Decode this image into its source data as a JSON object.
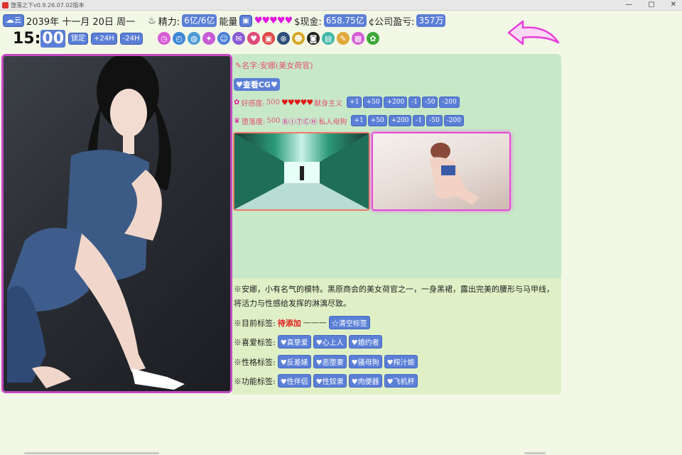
{
  "window": {
    "title": "堕落之下v0.9.26.07.02版本",
    "controls": [
      "—",
      "▢",
      "✕"
    ]
  },
  "header": {
    "weather_icon": "cloud-icon",
    "weather_label": "云",
    "date": "2039年 十一月 20日 周一",
    "energy_label": "精力:",
    "energy_value": "6亿/6亿",
    "power_label": "能量",
    "power_badge": "▣",
    "power_hearts": "♥♥♥♥♥",
    "cash_label": "$现金:",
    "cash_value": "658.75亿",
    "profit_label": "¢公司盈亏:",
    "profit_value": "357万",
    "time_hour": "15:",
    "time_min": "00",
    "lock_btn": "锁定",
    "plus24_btn": "+24H",
    "minus24_btn": "-24H"
  },
  "toolbar_icons": [
    {
      "name": "calendar-icon",
      "color": "#d65bd6",
      "glyph": "◷"
    },
    {
      "name": "clock-icon",
      "color": "#3f86d6",
      "glyph": "◴"
    },
    {
      "name": "globe-icon",
      "color": "#4c9bd6",
      "glyph": "◍"
    },
    {
      "name": "compass-icon",
      "color": "#c85bd6",
      "glyph": "✦"
    },
    {
      "name": "person-icon",
      "color": "#4a7fd6",
      "glyph": "☺"
    },
    {
      "name": "chat-icon",
      "color": "#8a5bd6",
      "glyph": "✉"
    },
    {
      "name": "heart-icon",
      "color": "#e04a7a",
      "glyph": "♥"
    },
    {
      "name": "bag-icon",
      "color": "#e04a4a",
      "glyph": "▣"
    },
    {
      "name": "lock-icon",
      "color": "#2f4f7a",
      "glyph": "⊗"
    },
    {
      "name": "mask-icon",
      "color": "#d6a82a",
      "glyph": "☻"
    },
    {
      "name": "gamepad-icon",
      "color": "#222222",
      "glyph": "◙"
    },
    {
      "name": "message-icon",
      "color": "#3fb6a8",
      "glyph": "▤"
    },
    {
      "name": "note-icon",
      "color": "#e0a83a",
      "glyph": "✎"
    },
    {
      "name": "card-icon",
      "color": "#d65bd6",
      "glyph": "▦"
    },
    {
      "name": "gear-icon",
      "color": "#3fa83a",
      "glyph": "✿"
    }
  ],
  "character": {
    "name_line": "名字:安娜(美女荷官)",
    "view_cg": "♥查看CG♥",
    "affection_label": "好感度:",
    "affection_value": "500",
    "affection_hearts": "♥♥♥♥♥",
    "affection_suffix": "献身主义",
    "corruption_label": "堕落度:",
    "corruption_value": "500",
    "corruption_letters": "ⒷⒾⓉⒸⒽ",
    "corruption_suffix": "私人母狗",
    "adjust_buttons": [
      "+1",
      "+50",
      "+200",
      "-1",
      "-50",
      "-200"
    ]
  },
  "profile": {
    "description": "※安娜，小有名气的模特。黑原商会的美女荷官之一，一身黑裙，露出完美的腰形与马甲线，将活力与性感给发挥的淋漓尽致。",
    "current_tags_label": "※目前标签:",
    "current_tags_pending": "待添加",
    "current_tags_dash": "———",
    "clear_tags": "☆清空标签",
    "like_tags_label": "※喜爱标签:",
    "like_tags": [
      "♥真挚爱",
      "♥心上人",
      "♥婚约者"
    ],
    "personality_label": "※性格标签:",
    "personality_tags": [
      "♥反差婊",
      "♥恶堕妻",
      "♥骚母狗",
      "♥榨汁姬"
    ],
    "function_label": "※功能标签:",
    "function_tags": [
      "♥性伴侣",
      "♥性奴隶",
      "♥肉便器",
      "♥飞机杯"
    ]
  }
}
